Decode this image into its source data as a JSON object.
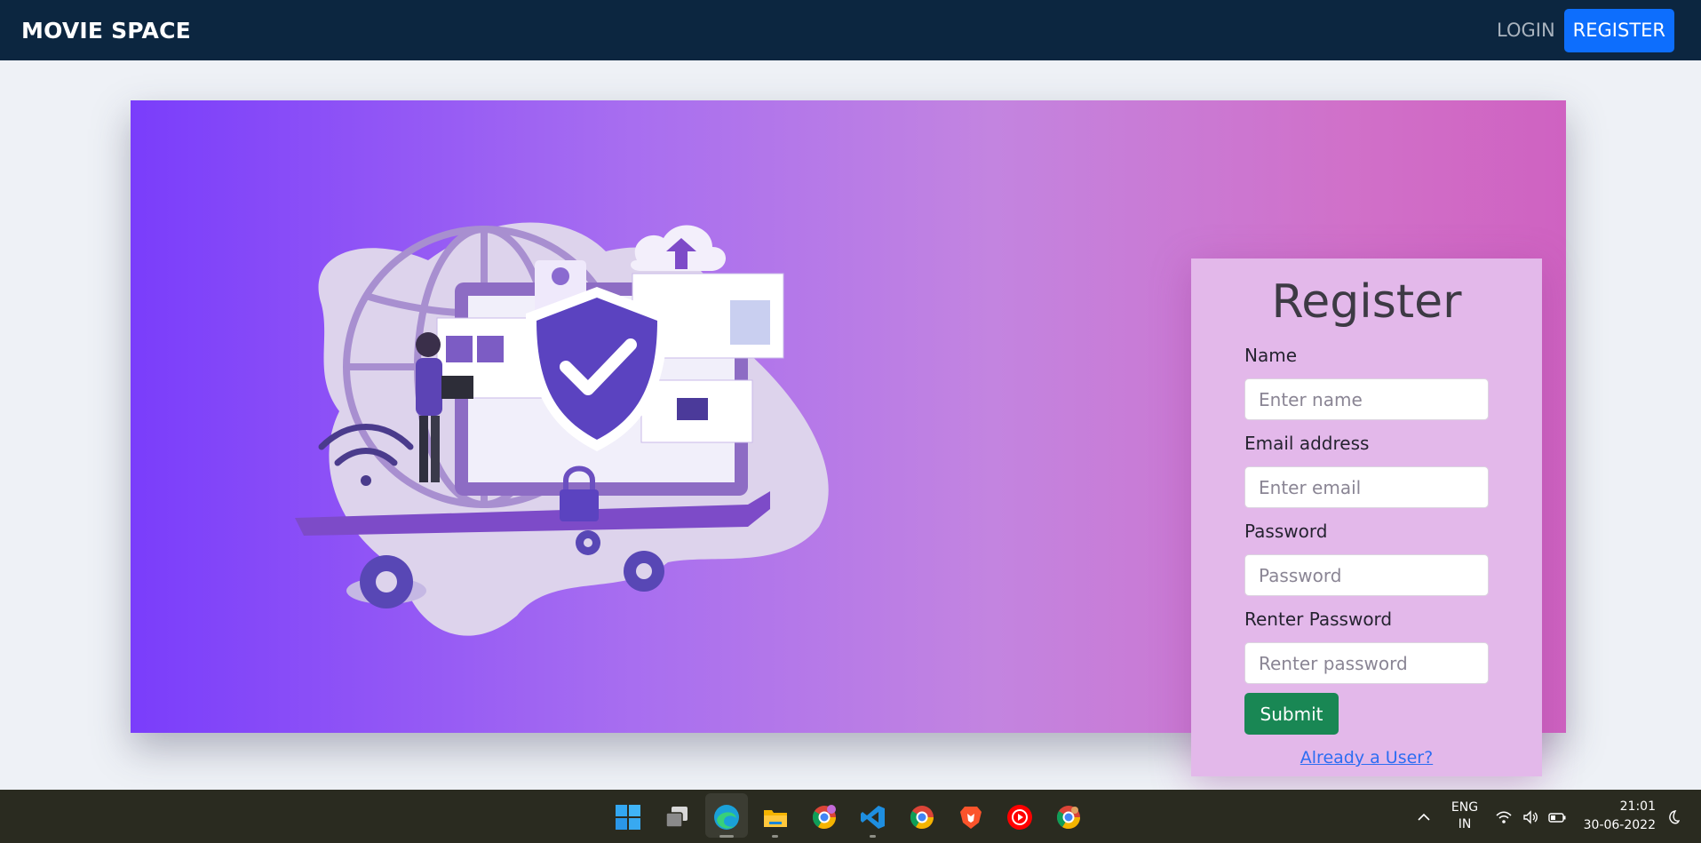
{
  "navbar": {
    "brand": "MOVIE SPACE",
    "login_label": "LOGIN",
    "register_label": "REGISTER"
  },
  "form": {
    "title": "Register",
    "fields": [
      {
        "label": "Name",
        "placeholder": "Enter name"
      },
      {
        "label": "Email address",
        "placeholder": "Enter email"
      },
      {
        "label": "Password",
        "placeholder": "Password"
      },
      {
        "label": "Renter Password",
        "placeholder": "Renter password"
      }
    ],
    "submit_label": "Submit",
    "already_link": "Already a User?"
  },
  "taskbar": {
    "apps": [
      "windows-start-icon",
      "task-view-icon",
      "edge-icon",
      "file-explorer-icon",
      "chrome-profile-icon",
      "vscode-icon",
      "chrome-icon",
      "brave-icon",
      "youtube-music-icon",
      "chrome-alt-icon"
    ],
    "language": "ENG",
    "region": "IN",
    "time": "21:01",
    "date": "30-06-2022"
  },
  "colors": {
    "navbar_bg": "#0c2640",
    "register_button": "#0d6efd",
    "submit_button": "#198754",
    "link": "#2c6df2",
    "form_card_bg": "#e3b8ea"
  }
}
